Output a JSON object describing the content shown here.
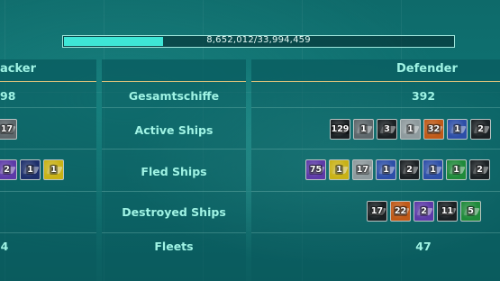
{
  "progress": {
    "text": "8,652,012/33,994,459",
    "fraction": 0.2545
  },
  "headers": {
    "attacker": "acker",
    "defender": "Defender"
  },
  "rows": [
    {
      "label": "Gesamtschiffe",
      "attacker_value": "98",
      "defender_value": "392"
    },
    {
      "label": "Active Ships"
    },
    {
      "label": "Fled Ships"
    },
    {
      "label": "Destroyed Ships"
    },
    {
      "label": "Fleets",
      "attacker_value": "4",
      "defender_value": "47"
    }
  ],
  "ship_colors": {
    "dark": "#1b2124",
    "grey": "#5d676b",
    "lightgrey": "#8e9a9d",
    "navy": "#1d2f6b",
    "blue": "#2d4fa8",
    "purple": "#5d3aa8",
    "green": "#1f8a3a",
    "orange": "#c05a18",
    "yellow": "#c9b216",
    "teal": "#0f6e68"
  },
  "attacker_active": [
    {
      "count": "17",
      "color": "grey",
      "icon": "ship-icon"
    }
  ],
  "attacker_fled": [
    {
      "count": "2",
      "color": "purple",
      "icon": "ship-icon"
    },
    {
      "count": "1",
      "color": "navy",
      "icon": "ship-icon"
    },
    {
      "count": "1",
      "color": "yellow",
      "icon": "ship-icon"
    }
  ],
  "defender_active": [
    {
      "count": "129",
      "color": "dark",
      "icon": "ship-icon"
    },
    {
      "count": "1",
      "color": "grey",
      "icon": "ship-icon"
    },
    {
      "count": "3",
      "color": "dark",
      "icon": "ship-icon"
    },
    {
      "count": "1",
      "color": "lightgrey",
      "icon": "ship-icon"
    },
    {
      "count": "32",
      "color": "orange",
      "icon": "ship-icon"
    },
    {
      "count": "1",
      "color": "blue",
      "icon": "ship-icon"
    },
    {
      "count": "2",
      "color": "dark",
      "icon": "ship-icon"
    }
  ],
  "defender_fled": [
    {
      "count": "75",
      "color": "purple",
      "icon": "ship-icon"
    },
    {
      "count": "1",
      "color": "yellow",
      "icon": "ship-icon"
    },
    {
      "count": "17",
      "color": "lightgrey",
      "icon": "ship-icon"
    },
    {
      "count": "1",
      "color": "blue",
      "icon": "ship-icon"
    },
    {
      "count": "2",
      "color": "dark",
      "icon": "ship-icon"
    },
    {
      "count": "1",
      "color": "blue",
      "icon": "ship-icon"
    },
    {
      "count": "1",
      "color": "green",
      "icon": "ship-icon"
    },
    {
      "count": "2",
      "color": "dark",
      "icon": "ship-icon"
    }
  ],
  "defender_destroyed": [
    {
      "count": "17",
      "color": "dark",
      "icon": "ship-icon"
    },
    {
      "count": "22",
      "color": "orange",
      "icon": "ship-icon"
    },
    {
      "count": "2",
      "color": "purple",
      "icon": "ship-icon"
    },
    {
      "count": "11",
      "color": "dark",
      "icon": "ship-icon"
    },
    {
      "count": "5",
      "color": "green",
      "icon": "ship-icon"
    }
  ]
}
